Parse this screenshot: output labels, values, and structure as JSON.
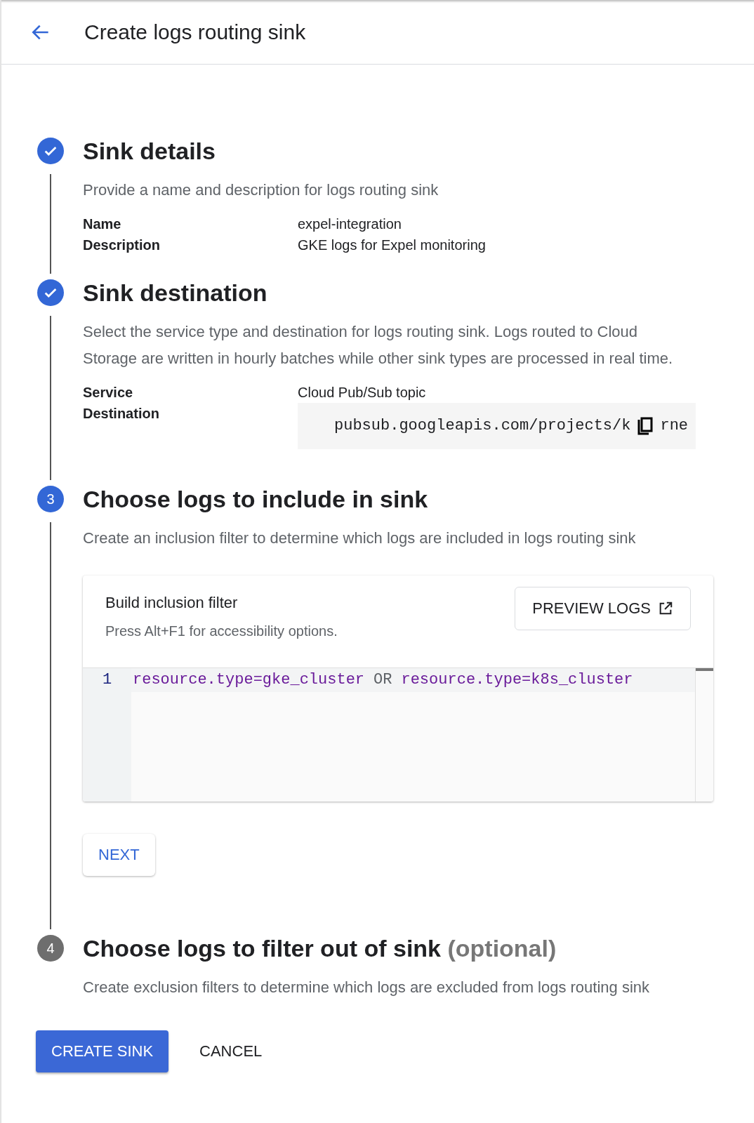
{
  "header": {
    "title": "Create logs routing sink"
  },
  "steps": [
    {
      "kind": "complete",
      "title": "Sink details",
      "description": "Provide a name and description for logs routing sink",
      "details": [
        {
          "label": "Name",
          "value": "expel-integration"
        },
        {
          "label": "Description",
          "value": "GKE logs for Expel monitoring"
        }
      ]
    },
    {
      "kind": "complete",
      "title": "Sink destination",
      "description": "Select the service type and destination for logs routing sink. Logs routed to Cloud Storage are written in hourly batches while other sink types are processed in real time.",
      "details": [
        {
          "label": "Service",
          "value": "Cloud Pub/Sub topic"
        },
        {
          "label": "Destination",
          "code": {
            "before": "pubsub.googleapis.com/projects/k",
            "after": "rne"
          }
        }
      ]
    },
    {
      "kind": "active",
      "number": "3",
      "title": "Choose logs to include in sink",
      "description": "Create an inclusion filter to determine which logs are included in logs routing sink",
      "filter": {
        "title": "Build inclusion filter",
        "hint": "Press Alt+F1 for accessibility options.",
        "preview_button": "PREVIEW LOGS",
        "lines": [
          {
            "number": "1",
            "tokens": [
              {
                "kind": "term",
                "text": "resource.type=gke_cluster"
              },
              {
                "kind": "operator",
                "text": "OR"
              },
              {
                "kind": "term",
                "text": "resource.type=k8s_cluster"
              }
            ]
          }
        ]
      },
      "next_button": "NEXT"
    },
    {
      "kind": "inactive",
      "number": "4",
      "title": "Choose logs to filter out of sink",
      "suffix": "(optional)",
      "description": "Create exclusion filters to determine which logs are excluded from logs routing sink"
    }
  ],
  "actions": {
    "primary": "CREATE SINK",
    "secondary": "CANCEL"
  }
}
